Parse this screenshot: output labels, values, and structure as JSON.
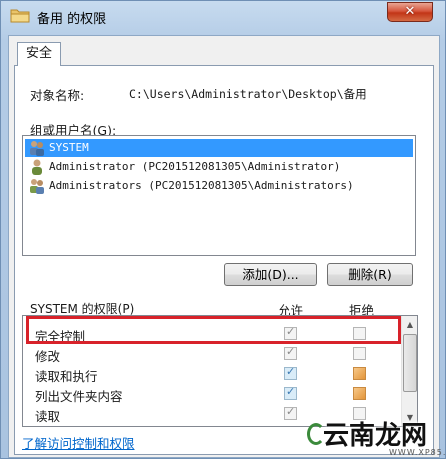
{
  "window": {
    "title": "备用 的权限",
    "close_label": "✕"
  },
  "tabs": [
    {
      "label": "安全"
    }
  ],
  "object": {
    "label": "对象名称:",
    "value": "C:\\Users\\Administrator\\Desktop\\备用"
  },
  "groups": {
    "label": "组或用户名(G):",
    "items": [
      {
        "name": "SYSTEM",
        "selected": true,
        "icon": "users-group-icon"
      },
      {
        "name": "Administrator (PC201512081305\\Administrator)",
        "selected": false,
        "icon": "user-icon"
      },
      {
        "name": "Administrators (PC201512081305\\Administrators)",
        "selected": false,
        "icon": "users-group-icon"
      }
    ]
  },
  "buttons": {
    "add": "添加(D)...",
    "remove": "删除(R)"
  },
  "permissions": {
    "label": "SYSTEM 的权限(P)",
    "allow_header": "允许",
    "deny_header": "拒绝",
    "rows": [
      {
        "name": "完全控制",
        "allow": "checked-gray",
        "deny": "empty"
      },
      {
        "name": "修改",
        "allow": "checked-gray",
        "deny": "empty"
      },
      {
        "name": "读取和执行",
        "allow": "checked-blue",
        "deny": "orange"
      },
      {
        "name": "列出文件夹内容",
        "allow": "checked-blue",
        "deny": "orange"
      },
      {
        "name": "读取",
        "allow": "checked-gray",
        "deny": "empty"
      }
    ]
  },
  "link": "了解访问控制和权限",
  "watermark": {
    "text": "云南龙网",
    "sub": "WWW.XP85.COM"
  },
  "colors": {
    "highlight": "#d8222a",
    "selection": "#3399ff",
    "link": "#0066cc"
  }
}
